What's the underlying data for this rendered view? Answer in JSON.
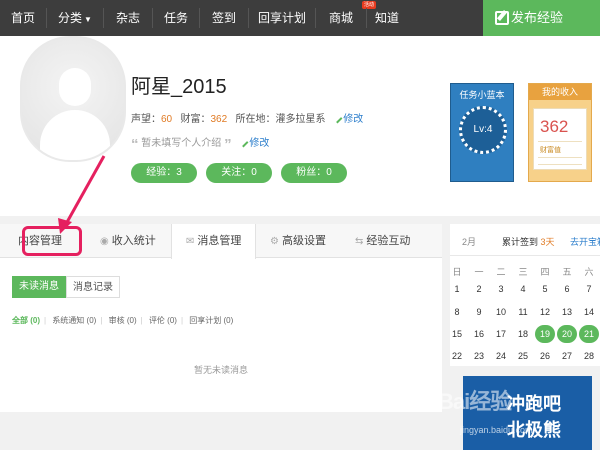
{
  "nav": {
    "items": [
      "首页",
      "分类",
      "杂志",
      "任务",
      "签到",
      "回享计划",
      "商城",
      "知道"
    ],
    "hot_badge": "活动",
    "publish": "发布经验"
  },
  "profile": {
    "name": "阿星_2015",
    "reputation_label": "声望：",
    "reputation": "60",
    "wealth_label": "财富：",
    "wealth": "362",
    "location_label": "所在地：",
    "location": "灌多拉星系",
    "edit": "修改",
    "intro": "暂未填写个人介绍",
    "pills": [
      "经验：3",
      "关注：0",
      "粉丝：0"
    ]
  },
  "task_card": {
    "title": "任务小蓝本",
    "level": "Lv:4"
  },
  "income_card": {
    "title": "我的收入",
    "value": "362",
    "label": "财富值"
  },
  "tabs": {
    "items": [
      "内容管理",
      "收入统计",
      "消息管理",
      "高级设置",
      "经验互动"
    ],
    "active": "消息管理"
  },
  "messages": {
    "unread": "未读消息",
    "history": "消息记录",
    "filters": [
      "全部 (0)",
      "系统通知 (0)",
      "审核 (0)",
      "评伦 (0)",
      "回享计划 (0)"
    ],
    "empty": "暂无未读消息"
  },
  "calendar": {
    "month": "2月",
    "total_label": "累计签到",
    "total_days": "3天",
    "open": "去开宝箱",
    "weekdays": [
      "日",
      "一",
      "二",
      "三",
      "四",
      "五",
      "六"
    ],
    "rows": [
      [
        "1",
        "2",
        "3",
        "4",
        "5",
        "6",
        "7"
      ],
      [
        "8",
        "9",
        "10",
        "11",
        "12",
        "13",
        "14"
      ],
      [
        "15",
        "16",
        "17",
        "18",
        "19",
        "20",
        "21"
      ],
      [
        "22",
        "23",
        "24",
        "25",
        "26",
        "27",
        "28"
      ]
    ],
    "signed": [
      "19",
      "20",
      "21"
    ]
  },
  "promo": {
    "line1": "冲跑吧",
    "line2": "北极熊"
  },
  "watermark": {
    "text": "Bai经验",
    "url": "jingyan.baidu.com"
  }
}
